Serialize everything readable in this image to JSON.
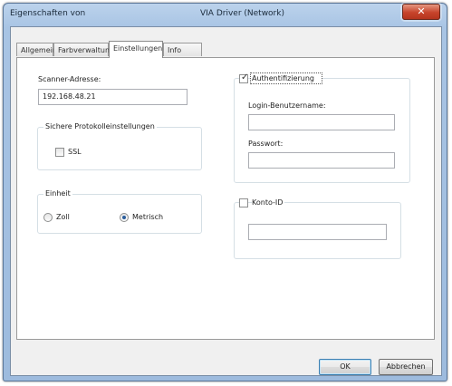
{
  "window": {
    "title_prefix": "Eigenschaften von",
    "title_name": "VIA Driver (Network)",
    "close_glyph": "✕"
  },
  "tabs": [
    {
      "label": "Allgemein"
    },
    {
      "label": "Farbverwaltung"
    },
    {
      "label": "Einstellungen",
      "active": true
    },
    {
      "label": "Info über"
    }
  ],
  "settings": {
    "scanner_address_label": "Scanner-Adresse:",
    "scanner_address_value": "192.168.48.21",
    "secure_group_title": "Sichere Protokolleinstellungen",
    "ssl_label": "SSL",
    "ssl_checked": false,
    "unit_group_title": "Einheit",
    "unit_options": [
      {
        "label": "Zoll",
        "selected": false
      },
      {
        "label": "Metrisch",
        "selected": true
      }
    ],
    "auth_label": "Authentifizierung",
    "auth_checked": true,
    "login_label": "Login-Benutzername:",
    "login_value": "",
    "password_label": "Passwort:",
    "password_value": "",
    "account_label": "Konto-ID",
    "account_checked": false,
    "account_value": ""
  },
  "buttons": {
    "ok_label": "OK",
    "cancel_label": "Abbrechen"
  },
  "colors": {
    "title_bar": "#a8c4e4",
    "close_button": "#c7432b",
    "radio_dot": "#2a5d9c"
  },
  "icons": {
    "check_mark": "✓"
  }
}
